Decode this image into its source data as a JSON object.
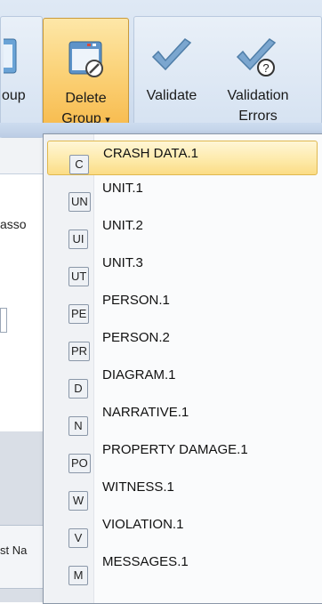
{
  "ribbon": {
    "partial_button_label": "oup",
    "delete_group": {
      "line1": "Delete",
      "line2": "Group",
      "chevron": "▾"
    },
    "validate_label": "Validate",
    "validation_errors": {
      "line1": "Validation",
      "line2": "Errors"
    }
  },
  "background": {
    "assoc_fragment": "asso",
    "name_fragment": "st Na"
  },
  "menu": {
    "items": [
      {
        "badge": "C",
        "label": "CRASH DATA.1"
      },
      {
        "badge": "UN",
        "label": "UNIT.1"
      },
      {
        "badge": "UI",
        "label": "UNIT.2"
      },
      {
        "badge": "UT",
        "label": "UNIT.3"
      },
      {
        "badge": "PE",
        "label": "PERSON.1"
      },
      {
        "badge": "PR",
        "label": "PERSON.2"
      },
      {
        "badge": "D",
        "label": "DIAGRAM.1"
      },
      {
        "badge": "N",
        "label": "NARRATIVE.1"
      },
      {
        "badge": "PO",
        "label": "PROPERTY DAMAGE.1"
      },
      {
        "badge": "W",
        "label": "WITNESS.1"
      },
      {
        "badge": "V",
        "label": "VIOLATION.1"
      },
      {
        "badge": "M",
        "label": "MESSAGES.1"
      }
    ]
  },
  "colors": {
    "highlight": "#fde9a7",
    "active_button": "#fbd37a"
  },
  "icons": [
    "form-icon",
    "delete-group-icon",
    "checkmark-icon",
    "checkmark-question-icon"
  ]
}
